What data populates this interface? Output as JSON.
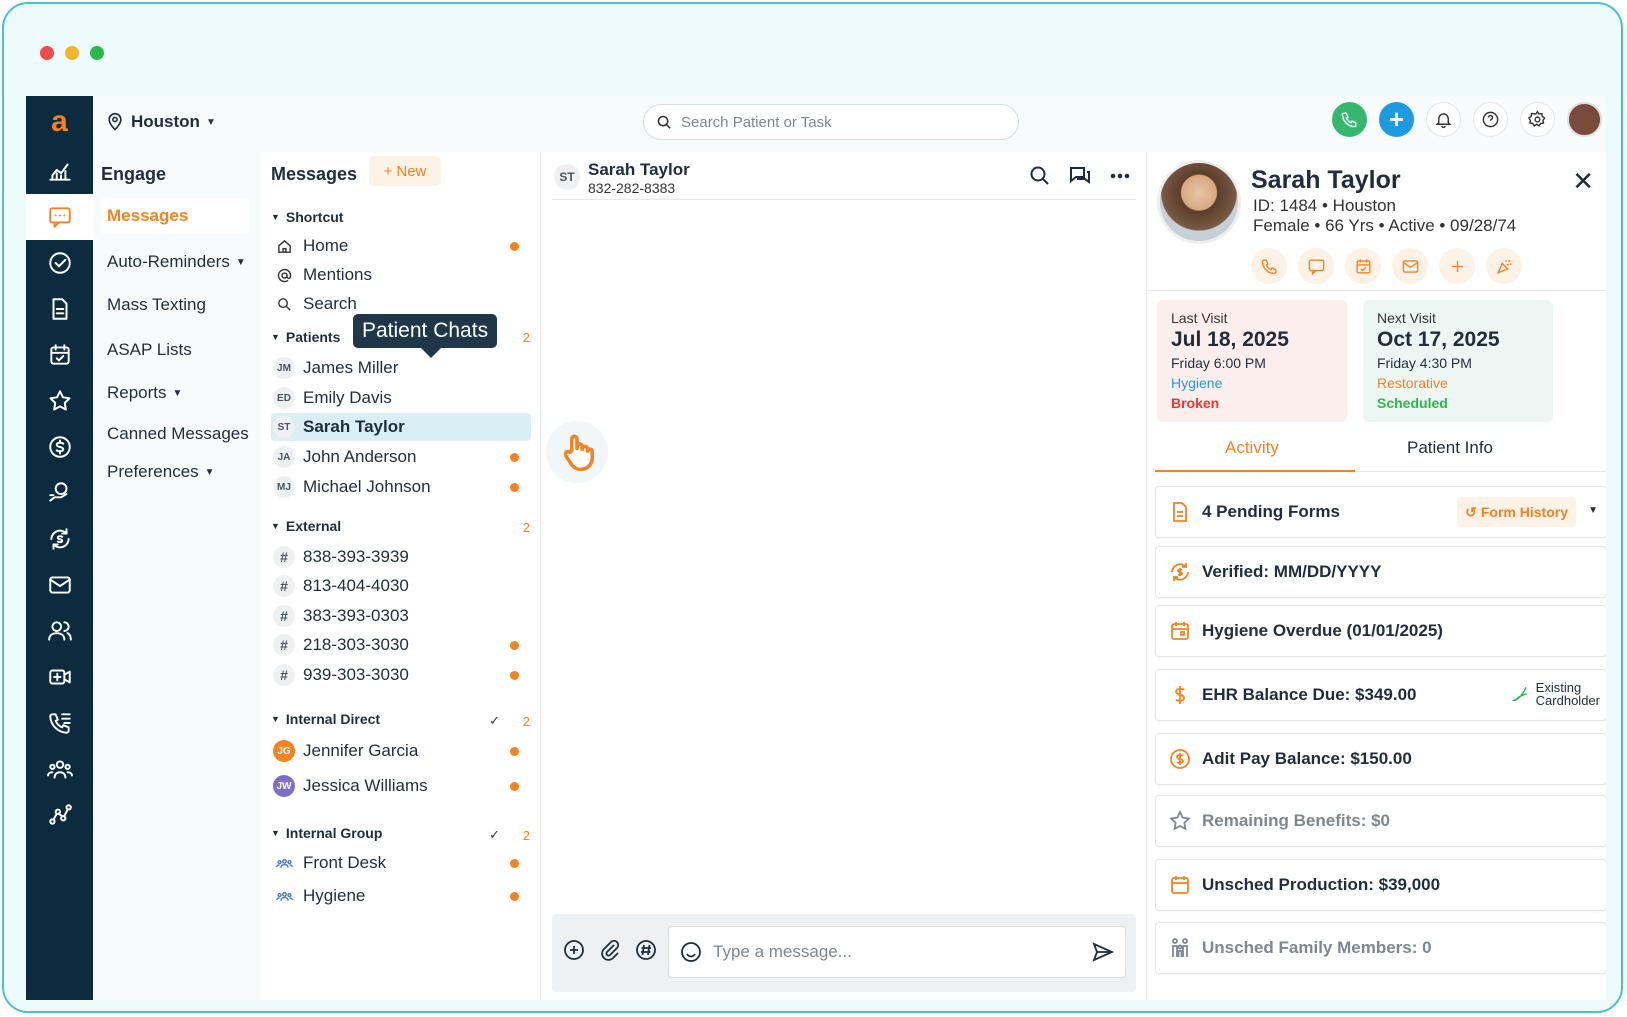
{
  "window": {
    "dots": [
      "#ee4c4c",
      "#f5b524",
      "#2bb84a"
    ]
  },
  "brand": {
    "logo": "a",
    "accent": "#f58220",
    "rail_bg": "#0d2b3e"
  },
  "topbar": {
    "location": "Houston",
    "search_placeholder": "Search Patient or Task"
  },
  "engage": {
    "title": "Engage",
    "items": [
      "Messages",
      "Auto-Reminders",
      "Mass Texting",
      "ASAP Lists",
      "Reports",
      "Canned Messages",
      "Preferences"
    ]
  },
  "messages": {
    "title": "Messages",
    "new_label": "New",
    "shortcut": {
      "label": "Shortcut",
      "items": [
        "Home",
        "Mentions",
        "Search"
      ]
    },
    "patients": {
      "label": "Patients",
      "count": "2",
      "items": [
        {
          "initials": "JM",
          "name": "James Miller"
        },
        {
          "initials": "ED",
          "name": "Emily Davis"
        },
        {
          "initials": "ST",
          "name": "Sarah Taylor"
        },
        {
          "initials": "JA",
          "name": "John Anderson"
        },
        {
          "initials": "MJ",
          "name": "Michael Johnson"
        }
      ]
    },
    "external": {
      "label": "External",
      "count": "2",
      "items": [
        "838-393-3939",
        "813-404-4030",
        "383-393-0303",
        "218-303-3030",
        "939-303-3030"
      ]
    },
    "internal_direct": {
      "label": "Internal Direct",
      "count": "2",
      "items": [
        {
          "initials": "JG",
          "name": "Jennifer Garcia"
        },
        {
          "initials": "JW",
          "name": "Jessica Williams"
        }
      ]
    },
    "internal_group": {
      "label": "Internal Group",
      "count": "2",
      "items": [
        "Front Desk",
        "Hygiene"
      ]
    },
    "tooltip": "Patient Chats"
  },
  "chat": {
    "initials": "ST",
    "name": "Sarah Taylor",
    "phone": "832-282-8383",
    "composer_placeholder": "Type a message..."
  },
  "patient": {
    "name": "Sarah Taylor",
    "id_line": "ID: 1484 • Houston",
    "demo_line": "Female • 66 Yrs • Active • 09/28/74",
    "last_visit": {
      "label": "Last Visit",
      "date": "Jul 18, 2025",
      "time": "Friday 6:00 PM",
      "type": "Hygiene",
      "status": "Broken"
    },
    "next_visit": {
      "label": "Next Visit",
      "date": "Oct 17, 2025",
      "time": "Friday 4:30 PM",
      "type": "Restorative",
      "status": "Scheduled"
    },
    "tabs": [
      "Activity",
      "Patient Info"
    ],
    "cards": {
      "forms": "4 Pending Forms",
      "form_history": "Form History",
      "verified": "Verified: MM/DD/YYYY",
      "hygiene": "Hygiene Overdue (01/01/2025)",
      "ehr": "EHR Balance Due: $349.00",
      "cardholder_1": "Existing",
      "cardholder_2": "Cardholder",
      "adit": "Adit Pay Balance: $150.00",
      "benefits": "Remaining Benefits: $0",
      "production": "Unsched Production: $39,000",
      "family": "Unsched Family Members: 0"
    }
  }
}
